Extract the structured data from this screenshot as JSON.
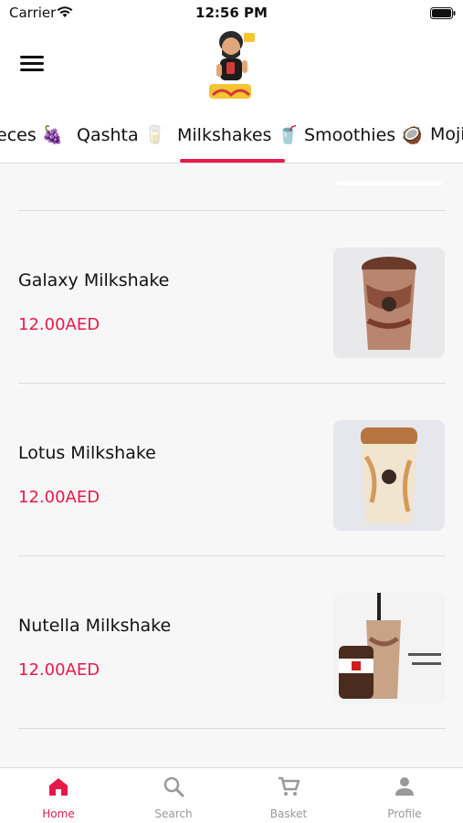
{
  "status": {
    "carrier": "Carrier",
    "time": "12:56 PM"
  },
  "header": {
    "menu_icon": "hamburger-menu-icon",
    "logo_icon": "cartoon-mascot-logo"
  },
  "categories": {
    "tabs": [
      {
        "label": "eces 🍇"
      },
      {
        "label": "Qashta 🥛"
      },
      {
        "label": "Milkshakes 🥤"
      },
      {
        "label": "Smoothies 🥥"
      },
      {
        "label": "Mojit"
      }
    ],
    "active_index": 2
  },
  "products": [
    {
      "name": "Galaxy Milkshake",
      "price": "12.00AED"
    },
    {
      "name": "Lotus Milkshake",
      "price": "12.00AED"
    },
    {
      "name": "Nutella Milkshake",
      "price": "12.00AED"
    }
  ],
  "tabbar": {
    "items": [
      {
        "label": "Home",
        "icon": "home-icon"
      },
      {
        "label": "Search",
        "icon": "search-icon"
      },
      {
        "label": "Basket",
        "icon": "cart-icon"
      },
      {
        "label": "Profile",
        "icon": "person-icon"
      }
    ],
    "active_index": 0
  },
  "colors": {
    "accent": "#e8194a",
    "inactive": "#999999",
    "background": "#f7f7f7"
  }
}
